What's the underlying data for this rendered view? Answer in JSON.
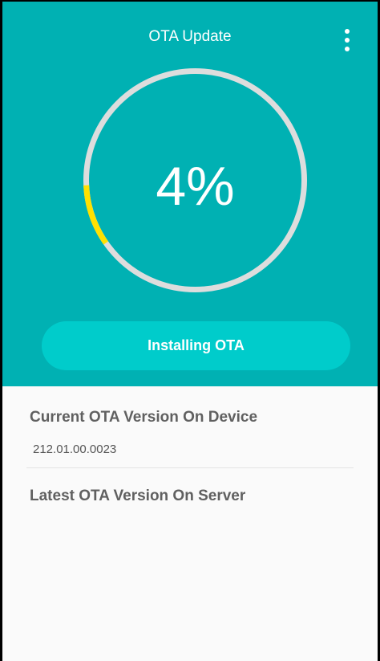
{
  "header": {
    "title": "OTA Update",
    "menu_icon": "more-vert-icon",
    "background_color": "#00b1b3"
  },
  "progress": {
    "percent_label": "4%",
    "value_percent": 4,
    "track_color": "#dddddd",
    "fill_color": "#ffe100"
  },
  "status_button": {
    "label": "Installing OTA",
    "color": "#00cccb"
  },
  "info": {
    "current_label": "Current OTA Version On Device",
    "current_value": "212.01.00.0023",
    "latest_label": "Latest OTA Version On Server"
  }
}
